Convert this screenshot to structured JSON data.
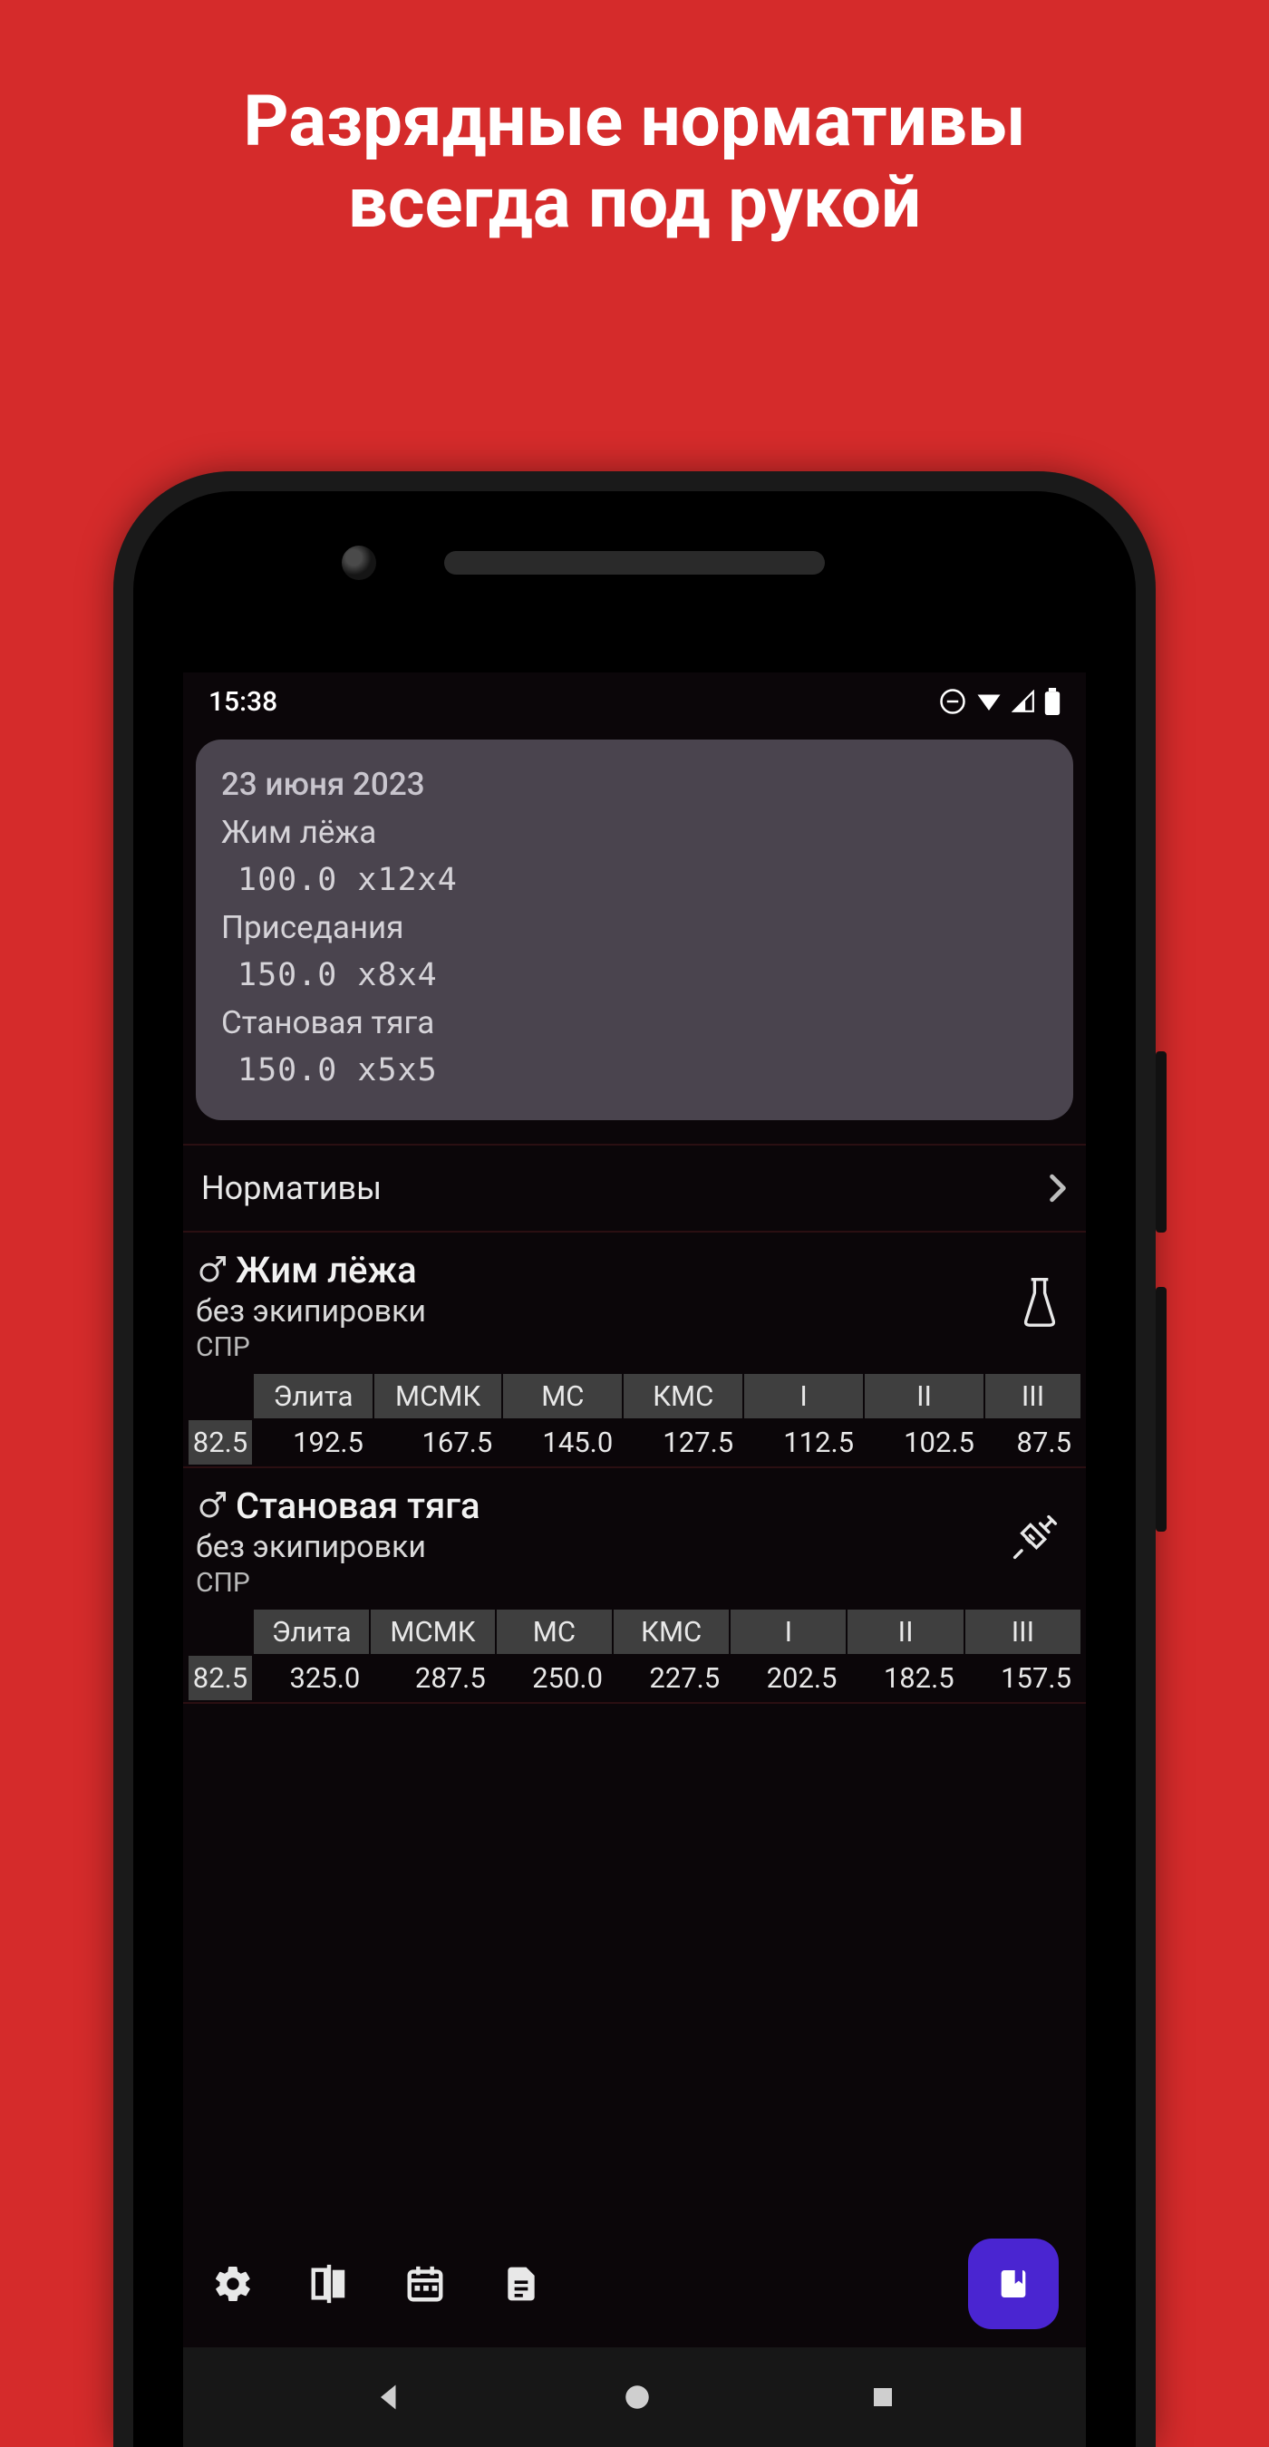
{
  "promo": {
    "line1": "Разрядные нормативы",
    "line2": "всегда под рукой"
  },
  "status": {
    "time": "15:38"
  },
  "workout_card": {
    "date": "23 июня 2023",
    "entries": [
      {
        "name": "Жим лёжа",
        "set": "100.0 x12x4"
      },
      {
        "name": "Приседания",
        "set": "150.0 x8x4"
      },
      {
        "name": "Становая тяга",
        "set": "150.0 x5x5"
      }
    ]
  },
  "standards_row": {
    "label": "Нормативы"
  },
  "grade_headers": [
    "Элита",
    "МСМК",
    "МС",
    "КМС",
    "I",
    "II",
    "III"
  ],
  "lifts": [
    {
      "title": "Жим лёжа",
      "sub": "без экипировки",
      "fed": "СПР",
      "icon": "flask",
      "weight_class": "82.5",
      "values": [
        "192.5",
        "167.5",
        "145.0",
        "127.5",
        "112.5",
        "102.5",
        "87.5"
      ]
    },
    {
      "title": "Становая тяга",
      "sub": "без экипировки",
      "fed": "СПР",
      "icon": "syringe",
      "weight_class": "82.5",
      "values": [
        "325.0",
        "287.5",
        "250.0",
        "227.5",
        "202.5",
        "182.5",
        "157.5"
      ]
    }
  ]
}
